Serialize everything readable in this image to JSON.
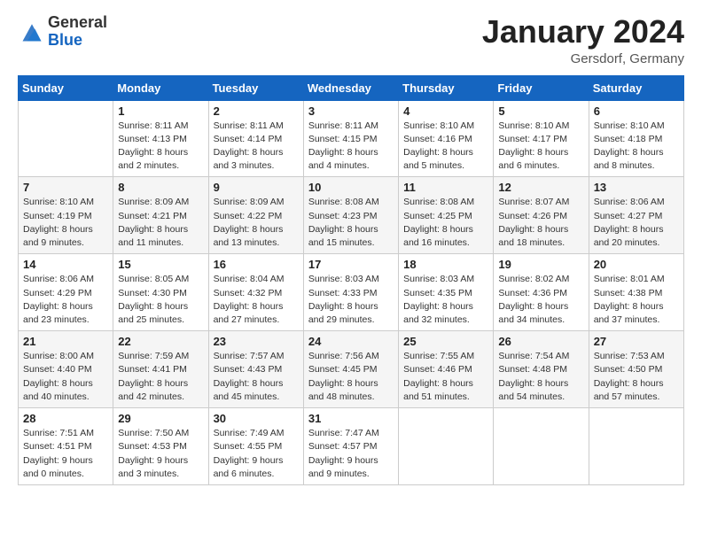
{
  "header": {
    "logo_general": "General",
    "logo_blue": "Blue",
    "month_title": "January 2024",
    "location": "Gersdorf, Germany"
  },
  "days_of_week": [
    "Sunday",
    "Monday",
    "Tuesday",
    "Wednesday",
    "Thursday",
    "Friday",
    "Saturday"
  ],
  "weeks": [
    [
      {
        "day": "",
        "sunrise": "",
        "sunset": "",
        "daylight": ""
      },
      {
        "day": "1",
        "sunrise": "Sunrise: 8:11 AM",
        "sunset": "Sunset: 4:13 PM",
        "daylight": "Daylight: 8 hours and 2 minutes."
      },
      {
        "day": "2",
        "sunrise": "Sunrise: 8:11 AM",
        "sunset": "Sunset: 4:14 PM",
        "daylight": "Daylight: 8 hours and 3 minutes."
      },
      {
        "day": "3",
        "sunrise": "Sunrise: 8:11 AM",
        "sunset": "Sunset: 4:15 PM",
        "daylight": "Daylight: 8 hours and 4 minutes."
      },
      {
        "day": "4",
        "sunrise": "Sunrise: 8:10 AM",
        "sunset": "Sunset: 4:16 PM",
        "daylight": "Daylight: 8 hours and 5 minutes."
      },
      {
        "day": "5",
        "sunrise": "Sunrise: 8:10 AM",
        "sunset": "Sunset: 4:17 PM",
        "daylight": "Daylight: 8 hours and 6 minutes."
      },
      {
        "day": "6",
        "sunrise": "Sunrise: 8:10 AM",
        "sunset": "Sunset: 4:18 PM",
        "daylight": "Daylight: 8 hours and 8 minutes."
      }
    ],
    [
      {
        "day": "7",
        "sunrise": "Sunrise: 8:10 AM",
        "sunset": "Sunset: 4:19 PM",
        "daylight": "Daylight: 8 hours and 9 minutes."
      },
      {
        "day": "8",
        "sunrise": "Sunrise: 8:09 AM",
        "sunset": "Sunset: 4:21 PM",
        "daylight": "Daylight: 8 hours and 11 minutes."
      },
      {
        "day": "9",
        "sunrise": "Sunrise: 8:09 AM",
        "sunset": "Sunset: 4:22 PM",
        "daylight": "Daylight: 8 hours and 13 minutes."
      },
      {
        "day": "10",
        "sunrise": "Sunrise: 8:08 AM",
        "sunset": "Sunset: 4:23 PM",
        "daylight": "Daylight: 8 hours and 15 minutes."
      },
      {
        "day": "11",
        "sunrise": "Sunrise: 8:08 AM",
        "sunset": "Sunset: 4:25 PM",
        "daylight": "Daylight: 8 hours and 16 minutes."
      },
      {
        "day": "12",
        "sunrise": "Sunrise: 8:07 AM",
        "sunset": "Sunset: 4:26 PM",
        "daylight": "Daylight: 8 hours and 18 minutes."
      },
      {
        "day": "13",
        "sunrise": "Sunrise: 8:06 AM",
        "sunset": "Sunset: 4:27 PM",
        "daylight": "Daylight: 8 hours and 20 minutes."
      }
    ],
    [
      {
        "day": "14",
        "sunrise": "Sunrise: 8:06 AM",
        "sunset": "Sunset: 4:29 PM",
        "daylight": "Daylight: 8 hours and 23 minutes."
      },
      {
        "day": "15",
        "sunrise": "Sunrise: 8:05 AM",
        "sunset": "Sunset: 4:30 PM",
        "daylight": "Daylight: 8 hours and 25 minutes."
      },
      {
        "day": "16",
        "sunrise": "Sunrise: 8:04 AM",
        "sunset": "Sunset: 4:32 PM",
        "daylight": "Daylight: 8 hours and 27 minutes."
      },
      {
        "day": "17",
        "sunrise": "Sunrise: 8:03 AM",
        "sunset": "Sunset: 4:33 PM",
        "daylight": "Daylight: 8 hours and 29 minutes."
      },
      {
        "day": "18",
        "sunrise": "Sunrise: 8:03 AM",
        "sunset": "Sunset: 4:35 PM",
        "daylight": "Daylight: 8 hours and 32 minutes."
      },
      {
        "day": "19",
        "sunrise": "Sunrise: 8:02 AM",
        "sunset": "Sunset: 4:36 PM",
        "daylight": "Daylight: 8 hours and 34 minutes."
      },
      {
        "day": "20",
        "sunrise": "Sunrise: 8:01 AM",
        "sunset": "Sunset: 4:38 PM",
        "daylight": "Daylight: 8 hours and 37 minutes."
      }
    ],
    [
      {
        "day": "21",
        "sunrise": "Sunrise: 8:00 AM",
        "sunset": "Sunset: 4:40 PM",
        "daylight": "Daylight: 8 hours and 40 minutes."
      },
      {
        "day": "22",
        "sunrise": "Sunrise: 7:59 AM",
        "sunset": "Sunset: 4:41 PM",
        "daylight": "Daylight: 8 hours and 42 minutes."
      },
      {
        "day": "23",
        "sunrise": "Sunrise: 7:57 AM",
        "sunset": "Sunset: 4:43 PM",
        "daylight": "Daylight: 8 hours and 45 minutes."
      },
      {
        "day": "24",
        "sunrise": "Sunrise: 7:56 AM",
        "sunset": "Sunset: 4:45 PM",
        "daylight": "Daylight: 8 hours and 48 minutes."
      },
      {
        "day": "25",
        "sunrise": "Sunrise: 7:55 AM",
        "sunset": "Sunset: 4:46 PM",
        "daylight": "Daylight: 8 hours and 51 minutes."
      },
      {
        "day": "26",
        "sunrise": "Sunrise: 7:54 AM",
        "sunset": "Sunset: 4:48 PM",
        "daylight": "Daylight: 8 hours and 54 minutes."
      },
      {
        "day": "27",
        "sunrise": "Sunrise: 7:53 AM",
        "sunset": "Sunset: 4:50 PM",
        "daylight": "Daylight: 8 hours and 57 minutes."
      }
    ],
    [
      {
        "day": "28",
        "sunrise": "Sunrise: 7:51 AM",
        "sunset": "Sunset: 4:51 PM",
        "daylight": "Daylight: 9 hours and 0 minutes."
      },
      {
        "day": "29",
        "sunrise": "Sunrise: 7:50 AM",
        "sunset": "Sunset: 4:53 PM",
        "daylight": "Daylight: 9 hours and 3 minutes."
      },
      {
        "day": "30",
        "sunrise": "Sunrise: 7:49 AM",
        "sunset": "Sunset: 4:55 PM",
        "daylight": "Daylight: 9 hours and 6 minutes."
      },
      {
        "day": "31",
        "sunrise": "Sunrise: 7:47 AM",
        "sunset": "Sunset: 4:57 PM",
        "daylight": "Daylight: 9 hours and 9 minutes."
      },
      {
        "day": "",
        "sunrise": "",
        "sunset": "",
        "daylight": ""
      },
      {
        "day": "",
        "sunrise": "",
        "sunset": "",
        "daylight": ""
      },
      {
        "day": "",
        "sunrise": "",
        "sunset": "",
        "daylight": ""
      }
    ]
  ]
}
